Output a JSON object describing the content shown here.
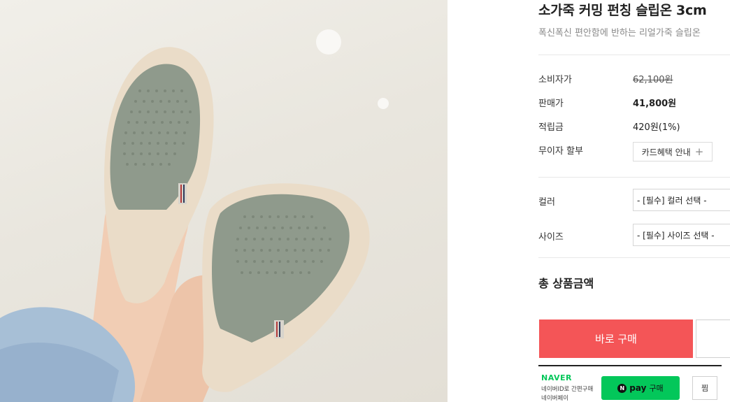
{
  "product": {
    "title": "소가죽 커밍 펀칭 슬립온 3cm",
    "subtitle": "폭신폭신 편안함에 반하는 리얼가죽 슬립온"
  },
  "price_rows": [
    {
      "label": "소비자가",
      "value": "62,100원"
    },
    {
      "label": "판매가",
      "value": "41,800원"
    },
    {
      "label": "적립금",
      "value": "420원(1%)"
    },
    {
      "label": "무이자 할부",
      "value": "카드혜택 안내"
    }
  ],
  "options": {
    "color_label": "컬러",
    "color_select": "- [필수] 컬러 선택 -",
    "size_label": "사이즈",
    "size_select": "- [필수] 사이즈 선택 -"
  },
  "total": {
    "label": "총 상품금액"
  },
  "actions": {
    "buy_now": "바로 구매"
  },
  "naver": {
    "brand": "NAVER",
    "line1": "네이버ID로 간편구매",
    "line2": "네이버페이",
    "pay_word": "pay",
    "pay_buy": "구매",
    "wish": "찜"
  },
  "colors": {
    "buy_button": "#f45557",
    "naver_green": "#03c75a",
    "shoe_leather": "#8f9a8c",
    "sole": "#ebdcc8"
  },
  "icons": {
    "card_info": "plus-icon",
    "npay": "npay-n-icon"
  }
}
